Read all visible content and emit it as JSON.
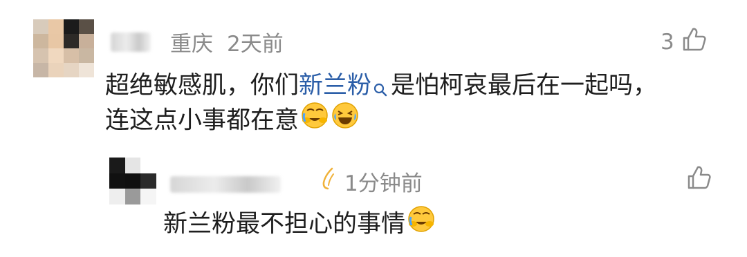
{
  "comment": {
    "location": "重庆",
    "time": "2天前",
    "like_count": "3",
    "text_part1": "超绝敏感肌，你们",
    "topic": "新兰粉",
    "text_part2": "是怕柯哀最后在一起吗，",
    "line2": "连这点小事都在意",
    "emojis": [
      "face-with-tears-covering-eyes-emoji",
      "laughing-tears-emoji"
    ]
  },
  "reply": {
    "time": "1分钟前",
    "text": "新兰粉最不担心的事情",
    "emojis": [
      "face-with-tears-covering-eyes-emoji"
    ]
  },
  "icons": {
    "like": "thumbs-up-outline-icon",
    "search": "search-icon",
    "badge": "lightning-badge-icon"
  },
  "colors": {
    "meta_text": "#8a8a8a",
    "topic_link": "#2b5ea8",
    "emoji_yellow": "#ffc93c"
  }
}
